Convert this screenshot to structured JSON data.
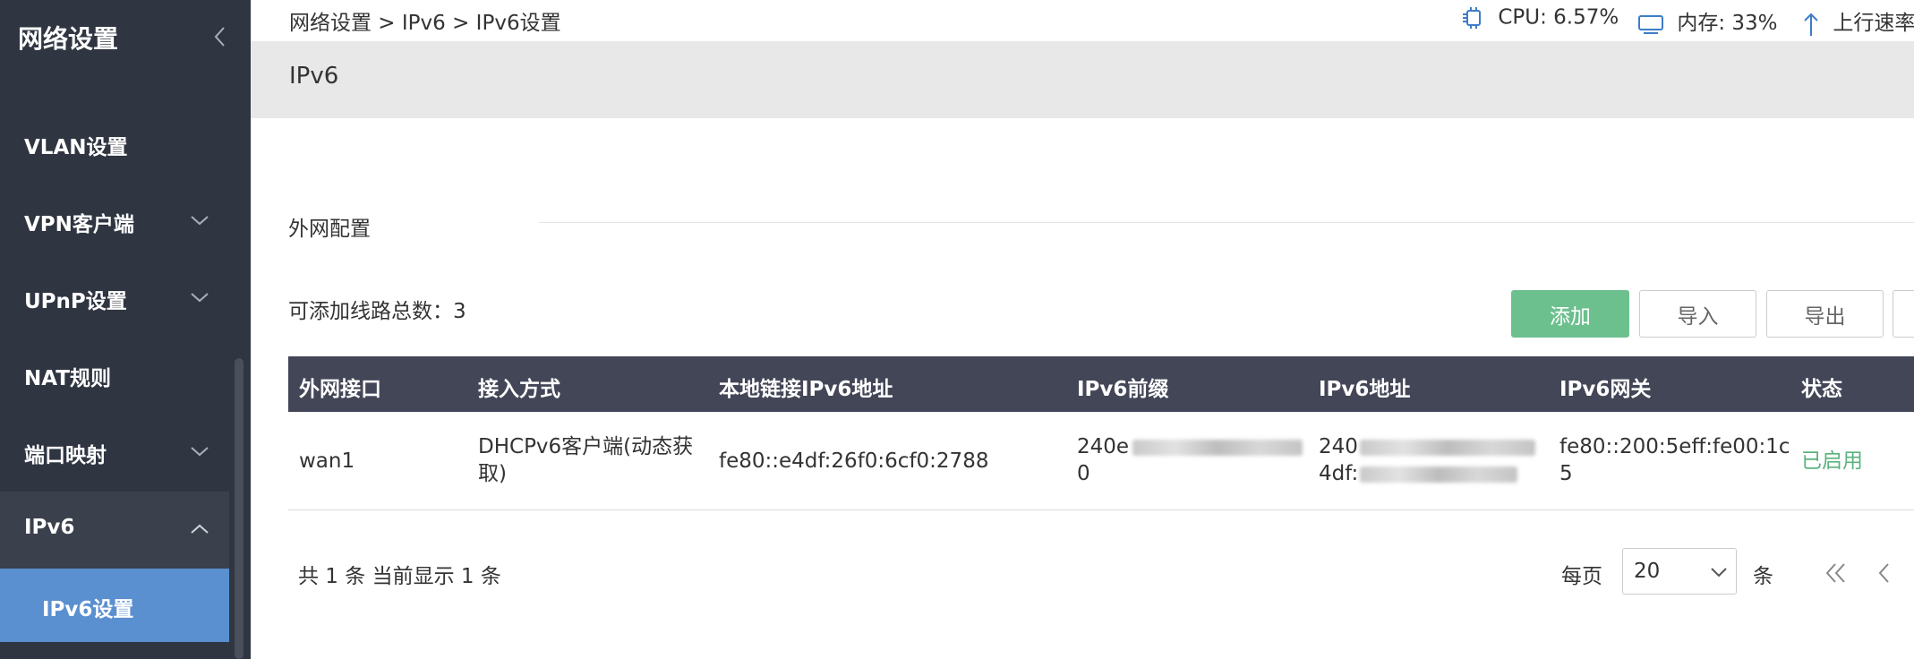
{
  "sidebar": {
    "title": "网络设置",
    "items": [
      {
        "label": "VLAN设置"
      },
      {
        "label": "VPN客户端"
      },
      {
        "label": "UPnP设置"
      },
      {
        "label": "NAT规则"
      },
      {
        "label": "端口映射"
      },
      {
        "label": "IPv6"
      }
    ],
    "active_sub": "IPv6设置"
  },
  "topbar": {
    "breadcrumb": "网络设置 > IPv6 > IPv6设置",
    "cpu": "CPU: 6.57%",
    "memory": "内存: 33%",
    "upload": "上行速率"
  },
  "page": {
    "title": "IPv6",
    "section_title": "外网配置",
    "line_count_text": "可添加线路总数：3"
  },
  "toolbar": {
    "add_label": "添加",
    "import_label": "导入",
    "export_label": "导出"
  },
  "table": {
    "columns": [
      "外网接口",
      "接入方式",
      "本地链接IPv6地址",
      "IPv6前缀",
      "IPv6地址",
      "IPv6网关",
      "状态"
    ],
    "rows": [
      {
        "interface": "wan1",
        "access_line1": "DHCPv6客户端(动态获",
        "access_line2": "取)",
        "link_local": "fe80::e4df:26f0:6cf0:2788",
        "prefix_line1": "240e",
        "prefix_line2": "0",
        "address_line1": "240",
        "address_line2": "4df:",
        "gateway_line1": "fe80::200:5eff:fe00:1c",
        "gateway_line2": "5",
        "status": "已启用"
      }
    ]
  },
  "pagination": {
    "summary": "共 1 条 当前显示 1 条",
    "per_page_label": "每页",
    "per_page_value": "20",
    "per_page_unit": "条"
  },
  "colors": {
    "sidebar_bg": "#2f3541",
    "active_sub_bg": "#5a8fd0",
    "table_header_bg": "#434657",
    "primary_button": "#6cc08e",
    "status_enabled": "#5cb37f"
  }
}
